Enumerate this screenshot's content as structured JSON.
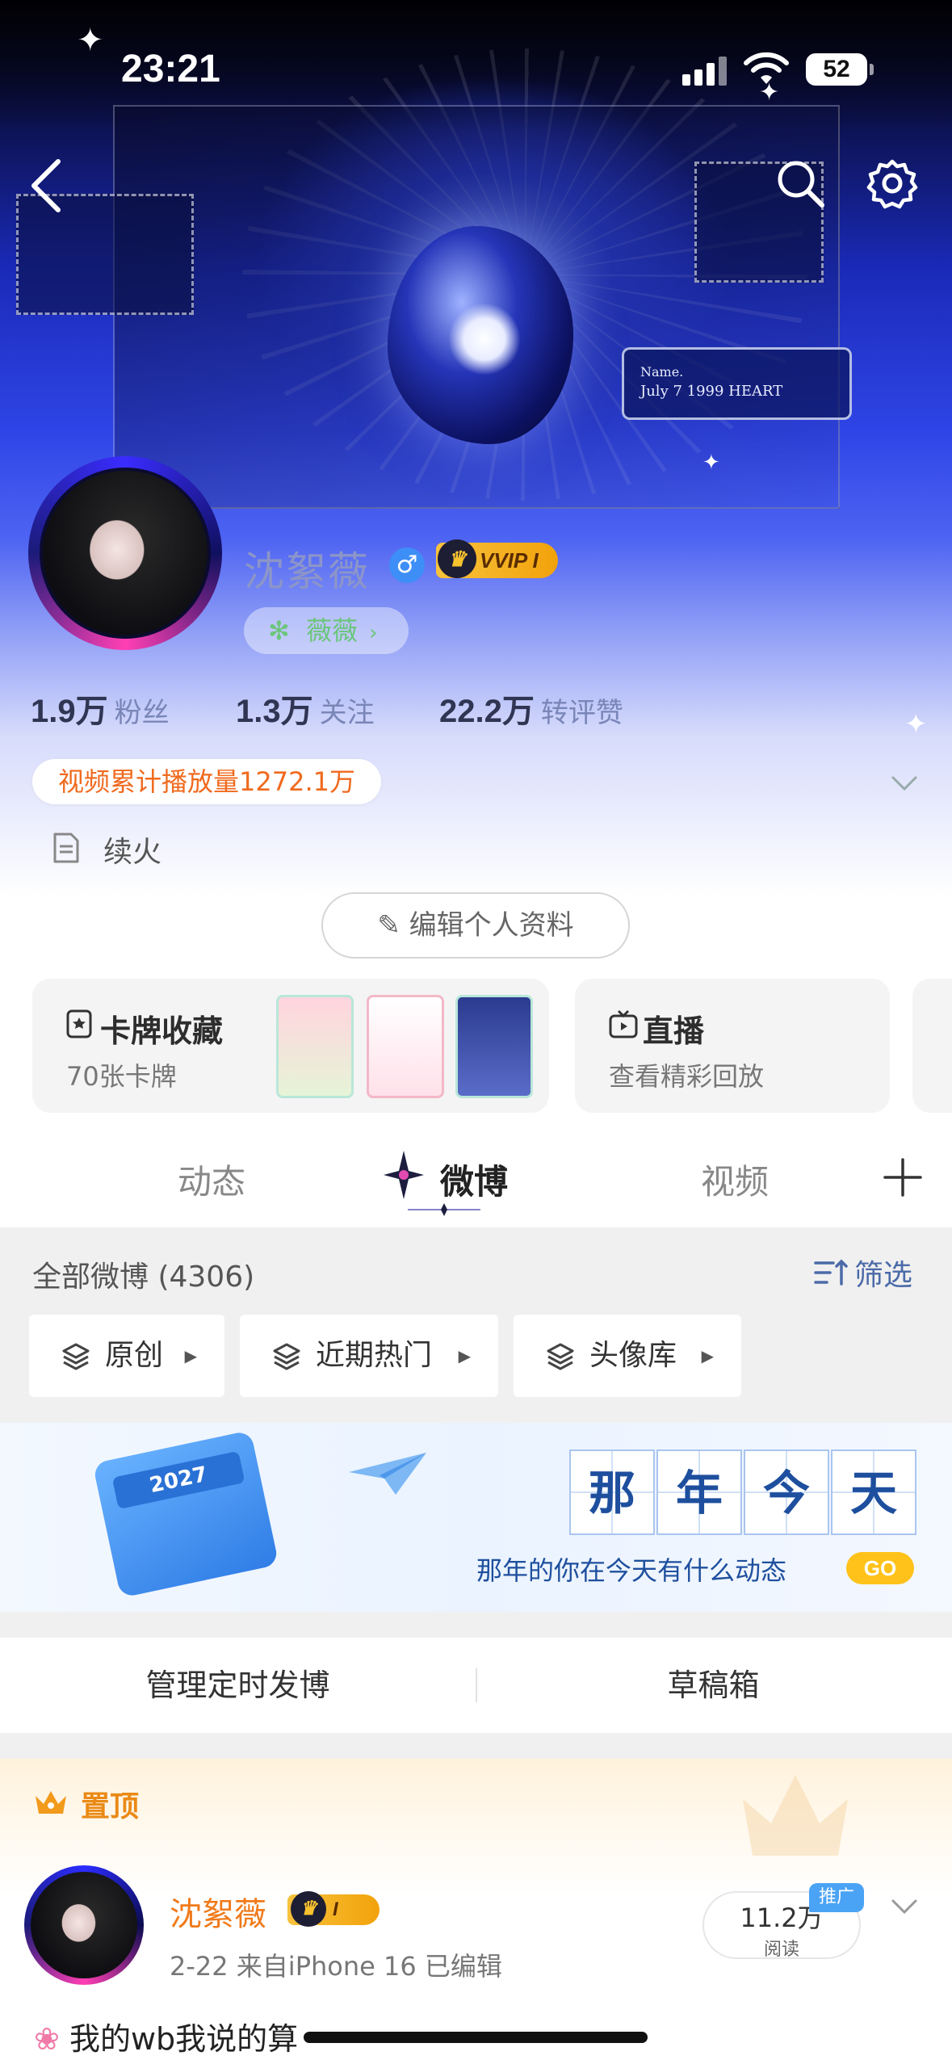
{
  "status_bar": {
    "time": "23:21",
    "battery": "52"
  },
  "profile": {
    "name": "沈絮薇",
    "vip_badge": "VVIP I",
    "fan_badge": "薇薇",
    "stats": [
      {
        "value": "1.9万",
        "label": "粉丝"
      },
      {
        "value": "1.3万",
        "label": "关注"
      },
      {
        "value": "22.2万",
        "label": "转评赞"
      }
    ],
    "play_count": "视频累计播放量1272.1万",
    "bio": "续火",
    "edit_button": "编辑个人资料"
  },
  "banner": {
    "tag_line1": "Name.",
    "tag_line2": "July 7 1999  HEART"
  },
  "cards": {
    "card_collection": {
      "title": "卡牌收藏",
      "subtitle": "70张卡牌"
    },
    "live": {
      "title": "直播",
      "subtitle": "查看精彩回放"
    }
  },
  "tabs": [
    {
      "label": "动态",
      "active": false
    },
    {
      "label": "微博",
      "active": true
    },
    {
      "label": "视频",
      "active": false
    }
  ],
  "feed": {
    "count_label": "全部微博 (4306)",
    "filter_label": "筛选",
    "chips": [
      "原创",
      "近期热门",
      "头像库"
    ]
  },
  "on_this_day": {
    "calendar_year": "2027",
    "title_chars": [
      "那",
      "年",
      "今",
      "天"
    ],
    "subtitle": "那年的你在今天有什么动态",
    "go": "GO"
  },
  "manage": {
    "scheduled": "管理定时发博",
    "drafts": "草稿箱"
  },
  "pinned_post": {
    "pin_label": "置顶",
    "author": "沈絮薇",
    "badge": "I",
    "meta": "2-22  来自iPhone 16  已编辑",
    "read_count": "11.2万",
    "read_label": "阅读",
    "promo": "推广",
    "text": "我的wb我说的算"
  },
  "colors": {
    "accent_orange": "#f07a1a",
    "link_blue": "#4b6aa8",
    "vip_gold": "#f7c23d"
  }
}
